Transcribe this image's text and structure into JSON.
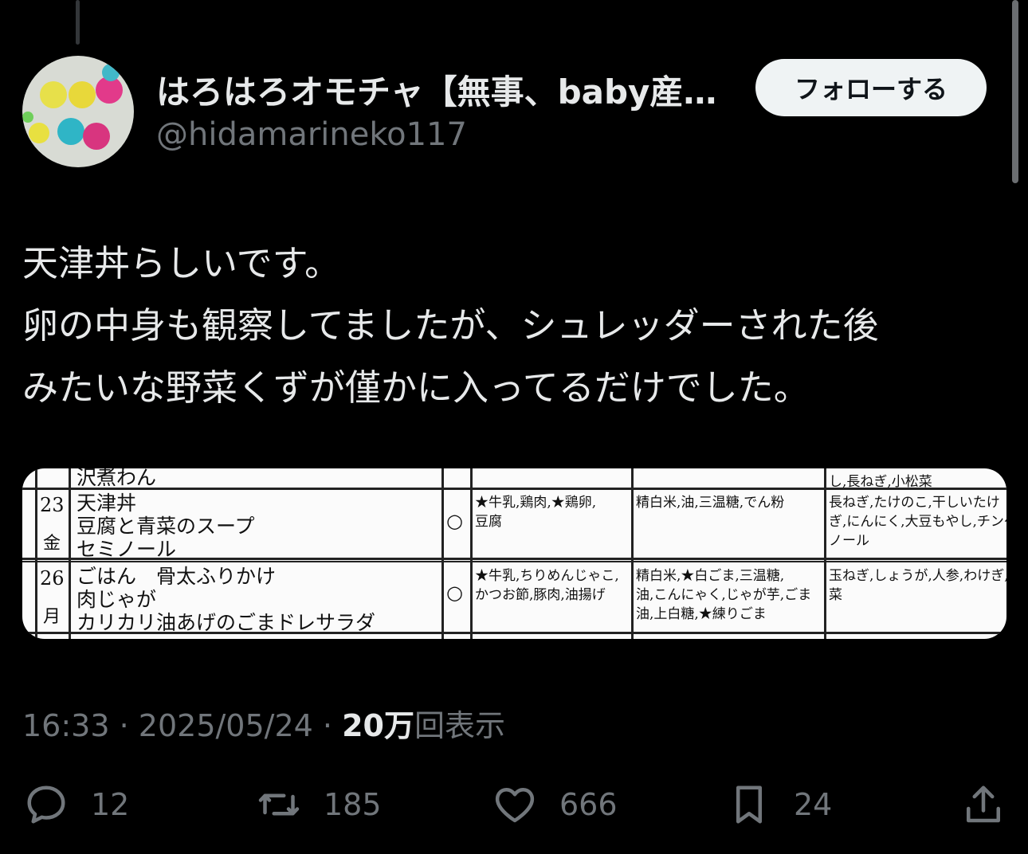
{
  "author": {
    "display_name": "はろはろオモチャ【無事、baby産…",
    "handle": "@hidamarineko117",
    "avatar_icon": "avatar-toy-balls-icon"
  },
  "follow_button": {
    "label": "フォローする"
  },
  "tweet": {
    "lines": [
      "天津丼らしいです。",
      "卵の中身も観察してましたが、シュレッダーされた後",
      "みたいな野菜くずが僅かに入ってるだけでした。"
    ]
  },
  "media": {
    "top_partial": "沢煮わん",
    "rows": [
      {
        "day_num": "23",
        "day_label": "金",
        "dishes": [
          "天津丼",
          "豆腐と青菜のスープ",
          "セミノール"
        ],
        "circle": "○",
        "col_a": [
          "★牛乳,鶏肉,★鶏卵,",
          "豆腐"
        ],
        "col_b": [
          "精白米,油,三温糖,でん粉"
        ],
        "col_c": [
          "長ねぎ,たけのこ,干しいたけ",
          "ぎ,にんにく,大豆もやし,チンゲ",
          "ノール"
        ]
      },
      {
        "day_num": "26",
        "day_label": "月",
        "dishes": [
          "ごはん　骨太ふりかけ",
          "肉じゃが",
          "カリカリ油あげのごまドレサラダ"
        ],
        "circle": "○",
        "col_a": [
          "★牛乳,ちりめんじゃこ,",
          "かつお節,豚肉,油揚げ"
        ],
        "col_b": [
          "精白米,★白ごま,三温糖,",
          "油,こんにゃく,じゃが芋,ごま",
          "油,上白糖,★練りごま"
        ],
        "col_c": [
          "玉ねぎ,しょうが,人参,わけぎ,",
          "菜"
        ]
      }
    ],
    "prev_col_c": "し,長ねぎ,小松菜"
  },
  "meta": {
    "time": "16:33",
    "sep": "·",
    "date": "2025/05/24",
    "views_count": "20万",
    "views_label": "回表示"
  },
  "actions": {
    "reply": {
      "icon": "reply-icon",
      "count": "12"
    },
    "repost": {
      "icon": "repost-icon",
      "count": "185"
    },
    "like": {
      "icon": "heart-icon",
      "count": "666"
    },
    "bookmark": {
      "icon": "bookmark-icon",
      "count": "24"
    },
    "share": {
      "icon": "share-icon"
    }
  },
  "colors": {
    "background": "#000000",
    "primary_text": "#e7e9ea",
    "secondary_text": "#71767b",
    "follow_bg": "#eff3f4"
  }
}
